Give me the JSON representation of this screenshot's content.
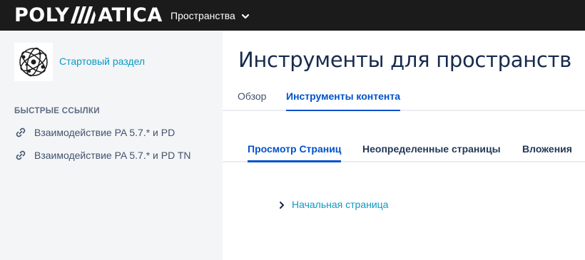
{
  "header": {
    "logo_left": "POLY",
    "logo_right": "ATICA",
    "spaces_menu_label": "Пространства"
  },
  "sidebar": {
    "space_name": "Стартовый раздел",
    "quick_links_title": "БЫСТРЫЕ ССЫЛКИ",
    "quick_links": [
      {
        "label": "Взаимодействие PA 5.7.* и PD"
      },
      {
        "label": "Взаимодействие PA 5.7.* и PD TN"
      }
    ]
  },
  "main": {
    "title": "Инструменты для пространств",
    "tabs": [
      {
        "label": "Обзор",
        "active": false
      },
      {
        "label": "Инструменты контента",
        "active": true
      }
    ],
    "subtabs": [
      {
        "label": "Просмотр Страниц",
        "active": true
      },
      {
        "label": "Неопределенные страницы",
        "active": false
      },
      {
        "label": "Вложения",
        "active": false
      }
    ],
    "tree": [
      {
        "label": "Начальная страница"
      }
    ]
  },
  "colors": {
    "topbar": "#1b1b1b",
    "sidebar_bg": "#f4f5f7",
    "link": "#0b9ac4",
    "accent": "#0052cc"
  }
}
